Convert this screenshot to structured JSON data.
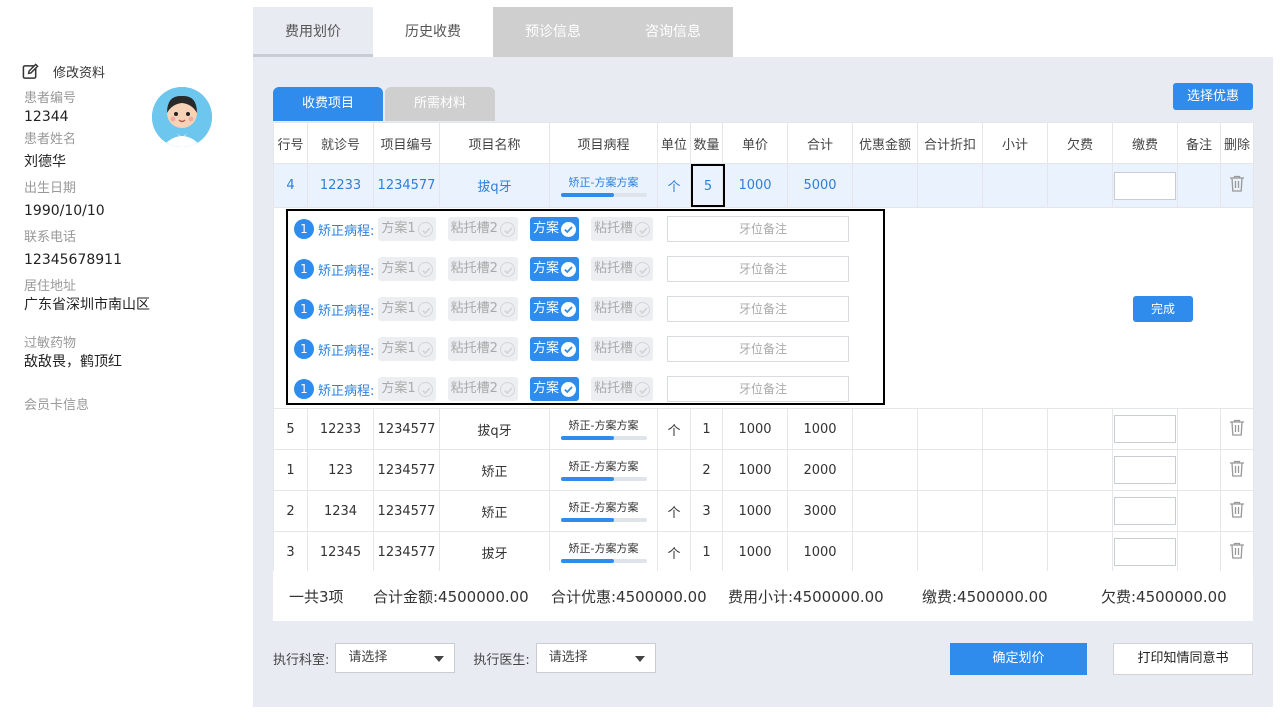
{
  "top_tabs": [
    "费用划价",
    "历史收费",
    "预诊信息",
    "咨询信息"
  ],
  "patient": {
    "edit_label": "修改资料",
    "fields": [
      {
        "label": "患者编号",
        "value": "12344"
      },
      {
        "label": "患者姓名",
        "value": "刘德华"
      },
      {
        "label": "出生日期",
        "value": "1990/10/10"
      },
      {
        "label": "联系电话",
        "value": "12345678911"
      },
      {
        "label": "居住地址",
        "value": "广东省深圳市南山区"
      },
      {
        "label": "过敏药物",
        "value": "敌敌畏，鹤顶红"
      },
      {
        "label": "会员卡信息",
        "value": ""
      }
    ]
  },
  "sub_tabs": [
    "收费项目",
    "所需材料"
  ],
  "choose_discount": "选择优惠",
  "table": {
    "headers": [
      "行号",
      "就诊号",
      "项目编号",
      "项目名称",
      "项目病程",
      "单位",
      "数量",
      "单价",
      "合计",
      "优惠金额",
      "合计折扣",
      "小计",
      "欠费",
      "缴费",
      "备注",
      "删除"
    ],
    "selected_row": {
      "no": "4",
      "visit": "12233",
      "code": "1234577",
      "name": "拔q牙",
      "course": "矫正-方案方案",
      "progress": 0.62,
      "unit": "个",
      "qty": "5",
      "price": "1000",
      "total": "5000"
    },
    "rows": [
      {
        "no": "5",
        "visit": "12233",
        "code": "1234577",
        "name": "拔q牙",
        "course": "矫正-方案方案",
        "progress": 0.62,
        "unit": "个",
        "qty": "1",
        "price": "1000",
        "total": "1000"
      },
      {
        "no": "1",
        "visit": "123",
        "code": "1234577",
        "name": "矫正",
        "course": "矫正-方案方案",
        "progress": 0.62,
        "unit": "",
        "qty": "2",
        "price": "1000",
        "total": "2000"
      },
      {
        "no": "2",
        "visit": "1234",
        "code": "1234577",
        "name": "矫正",
        "course": "矫正-方案方案",
        "progress": 0.62,
        "unit": "个",
        "qty": "3",
        "price": "1000",
        "total": "3000"
      },
      {
        "no": "3",
        "visit": "12345",
        "code": "1234577",
        "name": "拔牙",
        "course": "矫正-方案方案",
        "progress": 0.62,
        "unit": "个",
        "qty": "1",
        "price": "1000",
        "total": "1000"
      }
    ]
  },
  "plan": {
    "badge": "1",
    "label": "矫正病程:",
    "chips": [
      {
        "text": "方案1",
        "on": false
      },
      {
        "text": "粘托槽2",
        "on": false
      },
      {
        "text": "方案",
        "on": true
      },
      {
        "text": "粘托槽",
        "on": false
      }
    ],
    "note_placeholder": "牙位备注",
    "row_count": 5,
    "done": "完成"
  },
  "totals": {
    "count": "一共3项",
    "amount": "合计金额:4500000.00",
    "discount": "合计优惠:4500000.00",
    "subtotal": "费用小计:4500000.00",
    "paid": "缴费:4500000.00",
    "owed": "欠费:4500000.00"
  },
  "footer": {
    "dept_label": "执行科室:",
    "dept_value": "请选择",
    "doctor_label": "执行医生:",
    "doctor_value": "请选择",
    "confirm": "确定划价",
    "print": "打印知情同意书"
  }
}
